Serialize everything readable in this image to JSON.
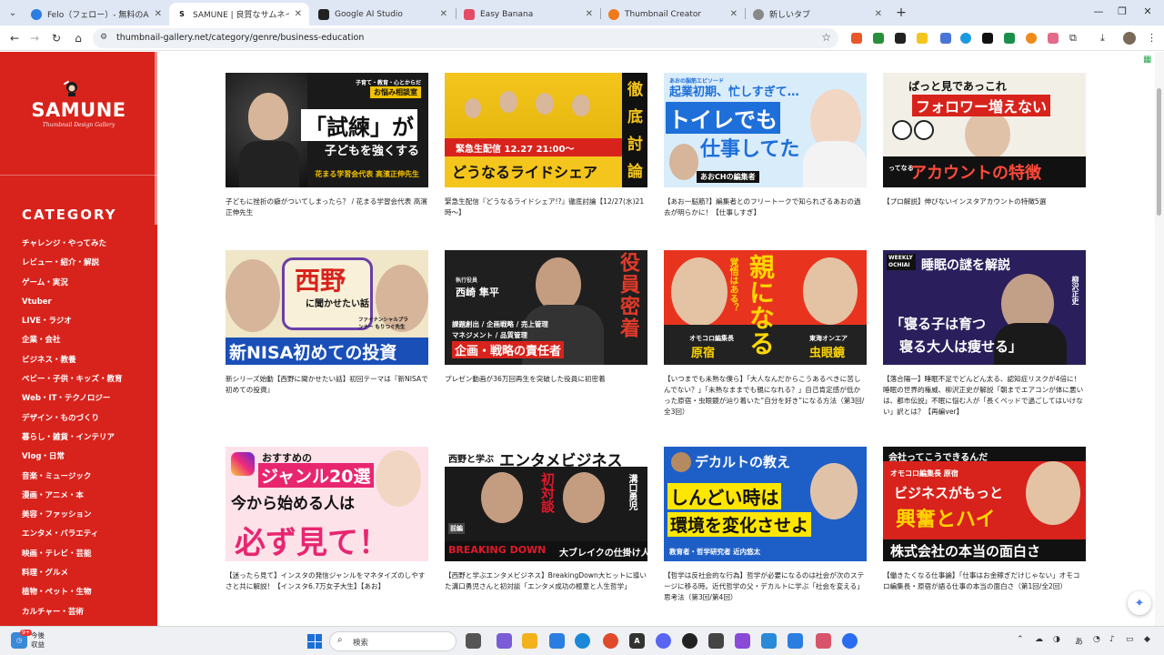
{
  "browser": {
    "tabs": [
      {
        "title": "Felo（フェロー）- 無料のAI検索エ",
        "favicon_color": "#2a7de1",
        "active": false
      },
      {
        "title": "SAMUNE | 良質なサムネイル専門",
        "favicon_color": "#111111",
        "active": true
      },
      {
        "title": "Google AI Studio",
        "favicon_color": "#222222",
        "active": false
      },
      {
        "title": "Easy Banana",
        "favicon_color": "#e44c65",
        "active": false
      },
      {
        "title": "Thumbnail Creator",
        "favicon_color": "#f07a1a",
        "active": false
      },
      {
        "title": "新しいタブ",
        "favicon_color": "#888888",
        "active": false
      }
    ],
    "url": "thumbnail-gallery.net/category/genre/business-education"
  },
  "sidebar": {
    "logo_text": "SAMUNE",
    "logo_sub": "Thumbnail Design Gallery",
    "category_heading": "CATEGORY",
    "categories": [
      "チャレンジ・やってみた",
      "レビュー・紹介・解説",
      "ゲーム・実況",
      "Vtuber",
      "LIVE・ラジオ",
      "企業・会社",
      "ビジネス・教養",
      "ベビー・子供・キッズ・教育",
      "Web・IT・テクノロジー",
      "デザイン・ものづくり",
      "暮らし・雑貨・インテリア",
      "Vlog・日常",
      "音楽・ミュージック",
      "漫画・アニメ・本",
      "美容・ファッション",
      "エンタメ・バラエティ",
      "映画・テレビ・芸能",
      "料理・グルメ",
      "植物・ペット・生物",
      "カルチャー・芸術"
    ]
  },
  "cards": [
    {
      "caption": "子どもに挫折の癖がついてしまったら？ / 花まる学習会代表 高濱正伸先生",
      "thumb": {
        "bg": "#1a1a1a",
        "accent": "#f2c200",
        "lines": [
          "子育て・教育・心とからだ",
          "お悩み相談室",
          "「試練」が",
          "子どもを強くする",
          "花まる学習会代表 高濱正伸先生"
        ]
      }
    },
    {
      "caption": "緊急生配信『どうなるライドシェア!?』徹底討論【12/27(水)21時〜】",
      "thumb": {
        "bg": "#f4c51c",
        "accent": "#111111",
        "lines": [
          "緊急生配信 12.27 21:00〜",
          "どうなるライドシェア",
          "徹",
          "底",
          "討",
          "論"
        ]
      }
    },
    {
      "caption": "【あお一脳筋?】編集者とのフリートークで知られざるあおの過去が明らかに！【仕事しすぎ】",
      "thumb": {
        "bg": "#d9ecfa",
        "accent": "#1e6fd9",
        "lines": [
          "あおの脳筋エピソード",
          "起業初期、忙しすぎて…",
          "トイレでも",
          "仕事してた",
          "あおCHの編集者"
        ]
      }
    },
    {
      "caption": "【プロ解説】伸びないインスタアカウントの特徴5選",
      "thumb": {
        "bg": "#f2efe6",
        "accent": "#d8231c",
        "lines": [
          "ぱっと見であっこれ",
          "フォロワー増えない",
          "ってなる",
          "アカウントの特徴"
        ]
      }
    },
    {
      "caption": "新シリーズ始動【西野に聞かせたい話】初回テーマは『新NISAで初めての投資』",
      "thumb": {
        "bg": "#f0e6c8",
        "accent": "#d8231c",
        "lines": [
          "西野",
          "に聞かせたい話",
          "ファイナンシャルプランナー もりつぐ先生",
          "新NISA初めての投資"
        ]
      }
    },
    {
      "caption": "プレゼン動画が36万回再生を突破した役員に初密着",
      "thumb": {
        "bg": "#1f1f1f",
        "accent": "#e03a2a",
        "lines": [
          "執行役員",
          "西崎 隼平",
          "課題創出 / 企画戦略 / 売上管理",
          "マネジメント / 品質管理",
          "企画・戦略の責任者",
          "役員密着"
        ]
      }
    },
    {
      "caption": "【いつまでも未熟な僕ら】「大人なんだからこうあるべきに苦しんでない？」「未熟なままでも親になれる？」自己肯定感が低かった原宿・虫眼鏡が辿り着いた“自分を好き”になる方法（第3回/全3回）",
      "thumb": {
        "bg": "#e8341f",
        "accent": "#ffd700",
        "lines": [
          "覚悟はある？",
          "親になる",
          "オモコロ編集長",
          "原宿",
          "東海オンエア",
          "虫眼鏡"
        ]
      }
    },
    {
      "caption": "【落合陽一】睡眠不足でどんどん太る、認知症リスクが4倍に！睡眠の世界的権威、柳沢正史が解説「朝までエアコンが体に悪いは、都市伝説」不眠に悩む人が「長くベッドで過ごしてはいけない」訳とは？【再編ver】",
      "thumb": {
        "bg": "#2a1f5c",
        "accent": "#ffffff",
        "lines": [
          "WEEKLY OCHIAI",
          "睡眠の謎を解説",
          "柳沢正史",
          "「寝る子は育つ",
          "寝る大人は痩せる」"
        ]
      }
    },
    {
      "caption": "【迷ったら見て】インスタの発信ジャンルをマネタイズのしやすさと共に解説！【インスタ6.7万女子大生】【あお】",
      "thumb": {
        "bg": "#fde2ea",
        "accent": "#e8266f",
        "lines": [
          "おすすめの",
          "ジャンル20選",
          "今から始める人は",
          "必ず見て！"
        ]
      }
    },
    {
      "caption": "【西野と学ぶエンタメビジネス】BreakingDown大ヒットに導いた溝口勇児さんと初対談「エンタメ成功の極意と人生哲学」",
      "thumb": {
        "bg": "#1a1a1a",
        "accent": "#e0192a",
        "lines": [
          "西野と学ぶ",
          "エンタメビジネス",
          "初対談",
          "溝口勇児",
          "前編",
          "BREAKING DOWN",
          "大ブレイクの仕掛け人"
        ]
      }
    },
    {
      "caption": "【哲学は反社会的な行為】哲学が必要になるのは社会が次のステージに移る時。近代哲学の父・デカルトに学ぶ「社会を変える」思考法（第3回/第4回）",
      "thumb": {
        "bg": "#1e5fc7",
        "accent": "#ffe600",
        "lines": [
          "デカルトの教え",
          "しんどい時は",
          "環境を変化させよ",
          "教育者・哲学研究者 近内悠太"
        ]
      }
    },
    {
      "caption": "【働きたくなる仕事論】「仕事はお金稼ぎだけじゃない」オモコロ編集長・原宿が語る仕事の本当の面白さ（第1回/全2回）",
      "thumb": {
        "bg": "#d8231c",
        "accent": "#ffd400",
        "lines": [
          "会社ってこうできるんだ",
          "オモコロ編集長 原宿",
          "ビジネスがもっと",
          "興奮とハイ",
          "株式会社の本当の面白さ"
        ]
      }
    }
  ],
  "taskbar": {
    "weather_line1": "今後",
    "weather_line2": "収益",
    "weather_badge": "9+",
    "search_placeholder": "検索"
  }
}
